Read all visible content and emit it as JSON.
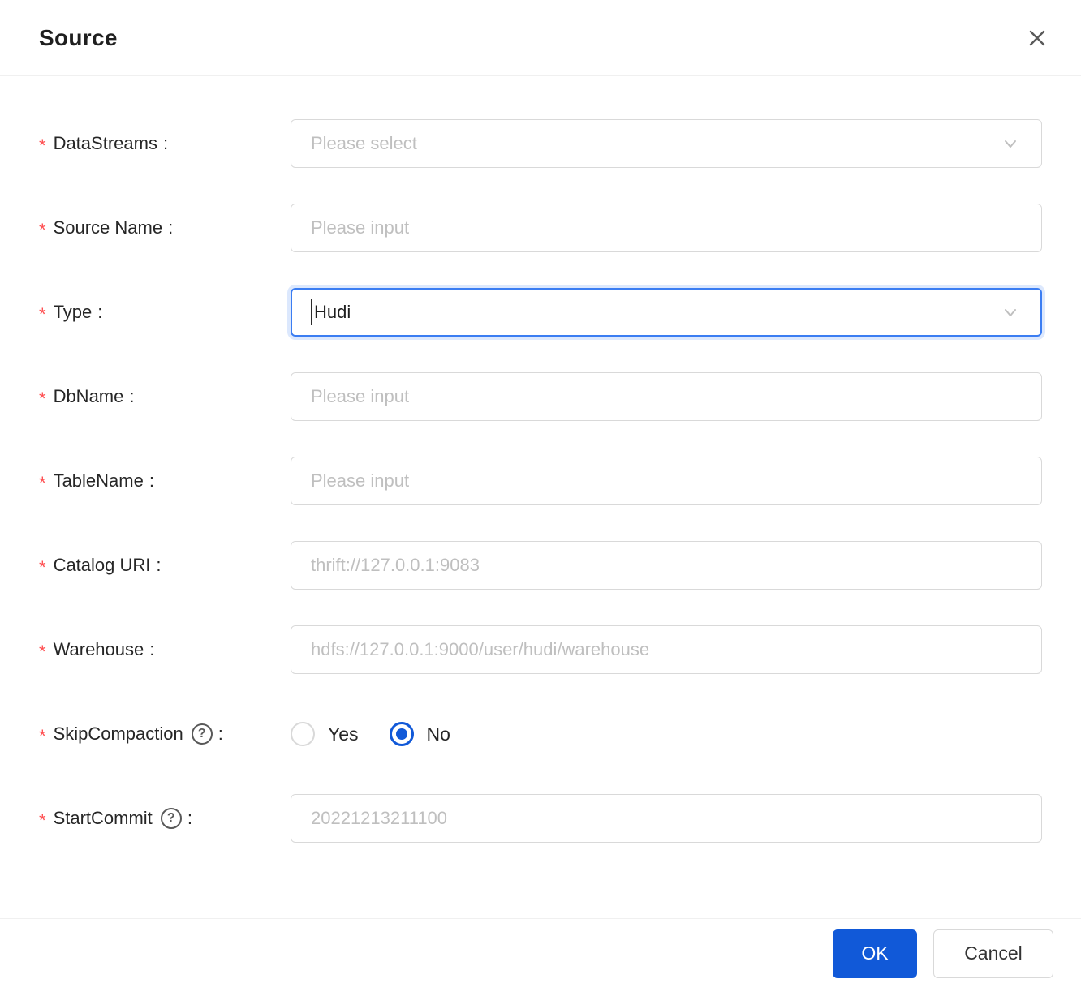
{
  "dialog": {
    "title": "Source",
    "required_mark": "*",
    "colon": ":",
    "help_glyph": "?",
    "fields": [
      {
        "label": "DataStreams",
        "required": true,
        "type": "select",
        "placeholder": "Please select"
      },
      {
        "label": "Source Name",
        "required": true,
        "type": "input",
        "placeholder": "Please input"
      },
      {
        "label": "Type",
        "required": true,
        "type": "select",
        "value": "Hudi",
        "focused": true
      },
      {
        "label": "DbName",
        "required": true,
        "type": "input",
        "placeholder": "Please input"
      },
      {
        "label": "TableName",
        "required": true,
        "type": "input",
        "placeholder": "Please input"
      },
      {
        "label": "Catalog URI",
        "required": true,
        "type": "input",
        "placeholder": "thrift://127.0.0.1:9083"
      },
      {
        "label": "Warehouse",
        "required": true,
        "type": "input",
        "placeholder": "hdfs://127.0.0.1:9000/user/hudi/warehouse"
      },
      {
        "label": "SkipCompaction",
        "required": true,
        "type": "radio",
        "has_help": true,
        "options": [
          "Yes",
          "No"
        ],
        "selected": "No"
      },
      {
        "label": "StartCommit",
        "required": true,
        "type": "input",
        "has_help": true,
        "placeholder": "20221213211100"
      }
    ],
    "footer": {
      "ok_label": "OK",
      "cancel_label": "Cancel"
    },
    "icons": [
      "close-icon",
      "chevron-down-icon",
      "question-circle-icon",
      "radio-checked-icon",
      "radio-unchecked-icon",
      "text-cursor"
    ],
    "colors": {
      "primary": "#1159d8",
      "focus_border": "#3b7df2",
      "danger": "#ff4d4f",
      "border": "#d9d9d9",
      "placeholder": "#bfbfbf",
      "divider": "#f0f0f0"
    }
  }
}
